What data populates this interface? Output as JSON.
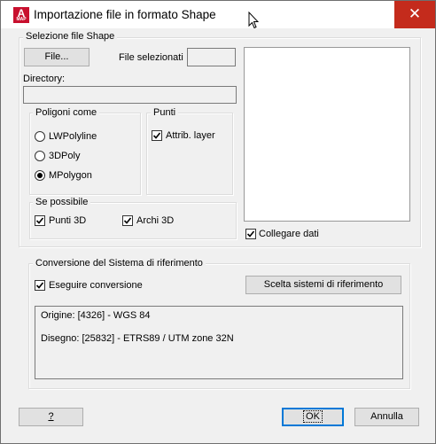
{
  "window": {
    "title": "Importazione file in formato Shape",
    "app_icon_letter": "A",
    "app_icon_sub": "MAP",
    "close_glyph": "✕"
  },
  "shape_group": {
    "legend": "Selezione file Shape",
    "file_button": "File...",
    "selected_files_label": "File selezionati",
    "selected_files_value": "",
    "directory_label": "Directory:",
    "directory_value": ""
  },
  "polygons_group": {
    "legend": "Poligoni come",
    "options": [
      {
        "label": "LWPolyline",
        "selected": false
      },
      {
        "label": "3DPoly",
        "selected": false
      },
      {
        "label": "MPolygon",
        "selected": true
      }
    ]
  },
  "points_group": {
    "legend": "Punti",
    "attrib_layer": {
      "label": "Attrib. layer",
      "checked": true
    }
  },
  "possible_group": {
    "legend": "Se possibile",
    "points3d": {
      "label": "Punti 3D",
      "checked": true
    },
    "arcs3d": {
      "label": "Archi 3D",
      "checked": true
    }
  },
  "link_data": {
    "label": "Collegare dati",
    "checked": true
  },
  "crs_group": {
    "legend": "Conversione del Sistema di riferimento",
    "execute": {
      "label": "Eseguire conversione",
      "checked": true
    },
    "choose_button": "Scelta sistemi di riferimento",
    "origin": "Origine: [4326] - WGS 84",
    "drawing": "Disegno: [25832] - ETRS89 / UTM zone 32N"
  },
  "footer": {
    "help_button": "?",
    "ok_button": "OK",
    "cancel_button": "Annulla"
  }
}
